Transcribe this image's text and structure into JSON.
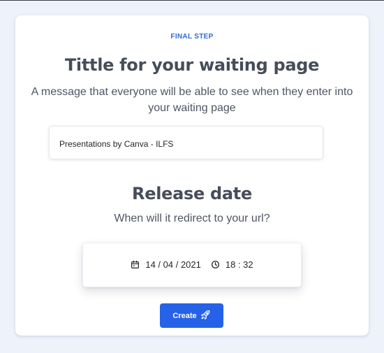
{
  "form": {
    "step_label": "FINAL STEP",
    "title": "Tittle for your waiting page",
    "subtitle": "A message that everyone will be able to see when they enter into your waiting page",
    "title_input_value": "Presentations by Canva - ILFS"
  },
  "release": {
    "title": "Release date",
    "subtitle": "When will it redirect to your url?",
    "date": "14 / 04 / 2021",
    "time": "18 : 32"
  },
  "actions": {
    "create_label": "Create"
  },
  "colors": {
    "accent": "#2562e8",
    "step": "#2f6ad9",
    "heading": "#464d5a",
    "background": "#eef2fb"
  },
  "icons": {
    "date": "calendar-icon",
    "time": "clock-icon",
    "create": "rocket-icon"
  }
}
